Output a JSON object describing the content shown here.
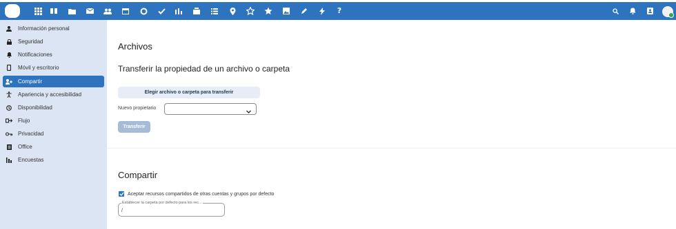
{
  "colors": {
    "accent": "#2e73be",
    "sidebar_bg": "#dbe5f3",
    "disabled_button": "#a4bcd8"
  },
  "topbar": {
    "app_icons": [
      "apps-grid-icon",
      "dashboard-icon",
      "files-icon",
      "mail-icon",
      "contacts-icon",
      "calendar-icon",
      "talk-icon",
      "tasks-icon",
      "activity-icon",
      "deck-icon",
      "notes-icon",
      "maps-icon",
      "starred-icon",
      "favorites-icon",
      "photos-icon",
      "edit-icon",
      "flash-icon",
      "help-icon"
    ],
    "right_icons": [
      "search-icon",
      "notifications-icon",
      "contacts-menu-icon",
      "avatar"
    ]
  },
  "sidebar": {
    "items": [
      {
        "label": "Información personal",
        "icon": "user-icon"
      },
      {
        "label": "Seguridad",
        "icon": "lock-icon"
      },
      {
        "label": "Notificaciones",
        "icon": "bell-icon"
      },
      {
        "label": "Móvil y escritorio",
        "icon": "phone-icon"
      },
      {
        "label": "Compartir",
        "icon": "share-icon",
        "active": true
      },
      {
        "label": "Apariencia y accesibilidad",
        "icon": "accessibility-icon"
      },
      {
        "label": "Disponibilidad",
        "icon": "clock-icon"
      },
      {
        "label": "Flujo",
        "icon": "flow-icon"
      },
      {
        "label": "Privacidad",
        "icon": "key-icon"
      },
      {
        "label": "Office",
        "icon": "office-icon"
      },
      {
        "label": "Encuestas",
        "icon": "poll-icon"
      }
    ]
  },
  "files_section": {
    "title": "Archivos",
    "subtitle": "Transferir la propiedad de un archivo o carpeta",
    "choose_button": "Elegir archivo o carpeta para transferir",
    "owner_label": "Nuevo propietario",
    "owner_value": "",
    "transfer_button": "Transferir"
  },
  "share_section": {
    "title": "Compartir",
    "accept_label": "Aceptar recursos compartidos de otras cuentas y grupos por defecto",
    "accept_checked": true,
    "folder_placeholder": "Establecer la carpeta por defecto para los rec...",
    "folder_value": "/"
  }
}
